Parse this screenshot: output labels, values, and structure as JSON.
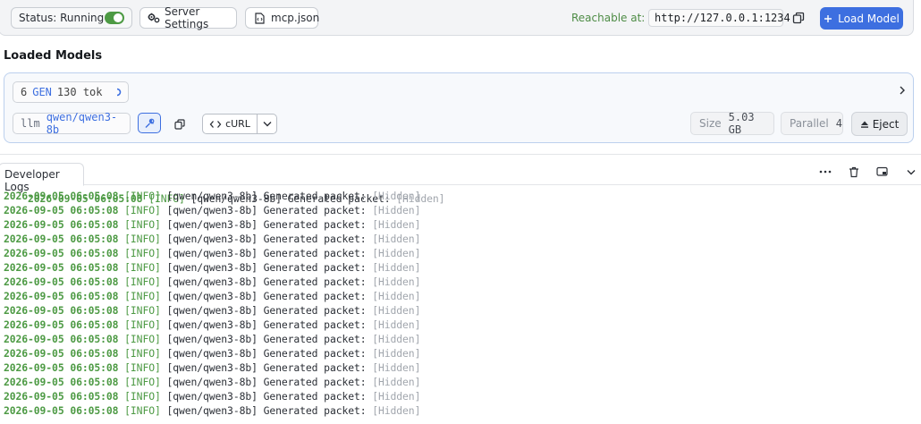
{
  "toolbar": {
    "status_label": "Status: Running",
    "server_settings_label": "Server Settings",
    "mcp_label": "mcp.json",
    "reachable_label": "Reachable at:",
    "url": "http://127.0.0.1:1234",
    "load_model_label": "Load Model"
  },
  "loaded_models": {
    "title": "Loaded Models",
    "gen_count": "6",
    "gen_label": "GEN",
    "tokens": "130 tok",
    "model_prefix": "llm",
    "model_name": "qwen/qwen3-8b",
    "curl_label": "cURL",
    "size_label": "Size",
    "size_value": "5.03 GB",
    "parallel_label": "Parallel",
    "parallel_value": "4",
    "eject_label": "Eject"
  },
  "logs": {
    "tab_label": "Developer Logs",
    "lines": [
      {
        "ts": "2026-09-05 06:05:08",
        "level": "[INFO]",
        "msg": "[qwen/qwen3-8b] Generated packet:",
        "tag": "[Hidden]"
      },
      {
        "ts": "2026-09-05 06:05:08",
        "level": "[INFO]",
        "msg": "[qwen/qwen3-8b] Generated packet:",
        "tag": "[Hidden]"
      },
      {
        "ts": "2026-09-05 06:05:08",
        "level": "[INFO]",
        "msg": "[qwen/qwen3-8b] Generated packet:",
        "tag": "[Hidden]"
      },
      {
        "ts": "2026-09-05 06:05:08",
        "level": "[INFO]",
        "msg": "[qwen/qwen3-8b] Generated packet:",
        "tag": "[Hidden]"
      },
      {
        "ts": "2026-09-05 06:05:08",
        "level": "[INFO]",
        "msg": "[qwen/qwen3-8b] Generated packet:",
        "tag": "[Hidden]"
      },
      {
        "ts": "2026-09-05 06:05:08",
        "level": "[INFO]",
        "msg": "[qwen/qwen3-8b] Generated packet:",
        "tag": "[Hidden]"
      },
      {
        "ts": "2026-09-05 06:05:08",
        "level": "[INFO]",
        "msg": "[qwen/qwen3-8b] Generated packet:",
        "tag": "[Hidden]"
      },
      {
        "ts": "2026-09-05 06:05:08",
        "level": "[INFO]",
        "msg": "[qwen/qwen3-8b] Generated packet:",
        "tag": "[Hidden]"
      },
      {
        "ts": "2026-09-05 06:05:08",
        "level": "[INFO]",
        "msg": "[qwen/qwen3-8b] Generated packet:",
        "tag": "[Hidden]"
      },
      {
        "ts": "2026-09-05 06:05:08",
        "level": "[INFO]",
        "msg": "[qwen/qwen3-8b] Generated packet:",
        "tag": "[Hidden]"
      },
      {
        "ts": "2026-09-05 06:05:08",
        "level": "[INFO]",
        "msg": "[qwen/qwen3-8b] Generated packet:",
        "tag": "[Hidden]"
      },
      {
        "ts": "2026-09-05 06:05:08",
        "level": "[INFO]",
        "msg": "[qwen/qwen3-8b] Generated packet:",
        "tag": "[Hidden]"
      },
      {
        "ts": "2026-09-05 06:05:08",
        "level": "[INFO]",
        "msg": "[qwen/qwen3-8b] Generated packet:",
        "tag": "[Hidden]"
      },
      {
        "ts": "2026-09-05 06:05:08",
        "level": "[INFO]",
        "msg": "[qwen/qwen3-8b] Generated packet:",
        "tag": "[Hidden]"
      },
      {
        "ts": "2026-09-05 06:05:08",
        "level": "[INFO]",
        "msg": "[qwen/qwen3-8b] Generated packet:",
        "tag": "[Hidden]"
      },
      {
        "ts": "2026-09-05 06:05:08",
        "level": "[INFO]",
        "msg": "[qwen/qwen3-8b] Generated packet:",
        "tag": "[Hidden]"
      },
      {
        "ts": "2026-09-05 06:05:08",
        "level": "[INFO]",
        "msg": "[qwen/qwen3-8b] Generated packet:",
        "tag": "[Hidden]"
      }
    ]
  },
  "colors": {
    "accent": "#3d6fe0",
    "status_green": "#4d9a44",
    "hidden_gray": "#a1a6ad"
  },
  "icons": [
    "gear-icon",
    "file-json-icon",
    "copy-icon",
    "plus-icon",
    "chevron-right-icon",
    "wrench-icon",
    "duplicate-icon",
    "code-icon",
    "chevron-down-icon",
    "eject-icon",
    "more-icon",
    "trash-icon",
    "panel-icon"
  ]
}
